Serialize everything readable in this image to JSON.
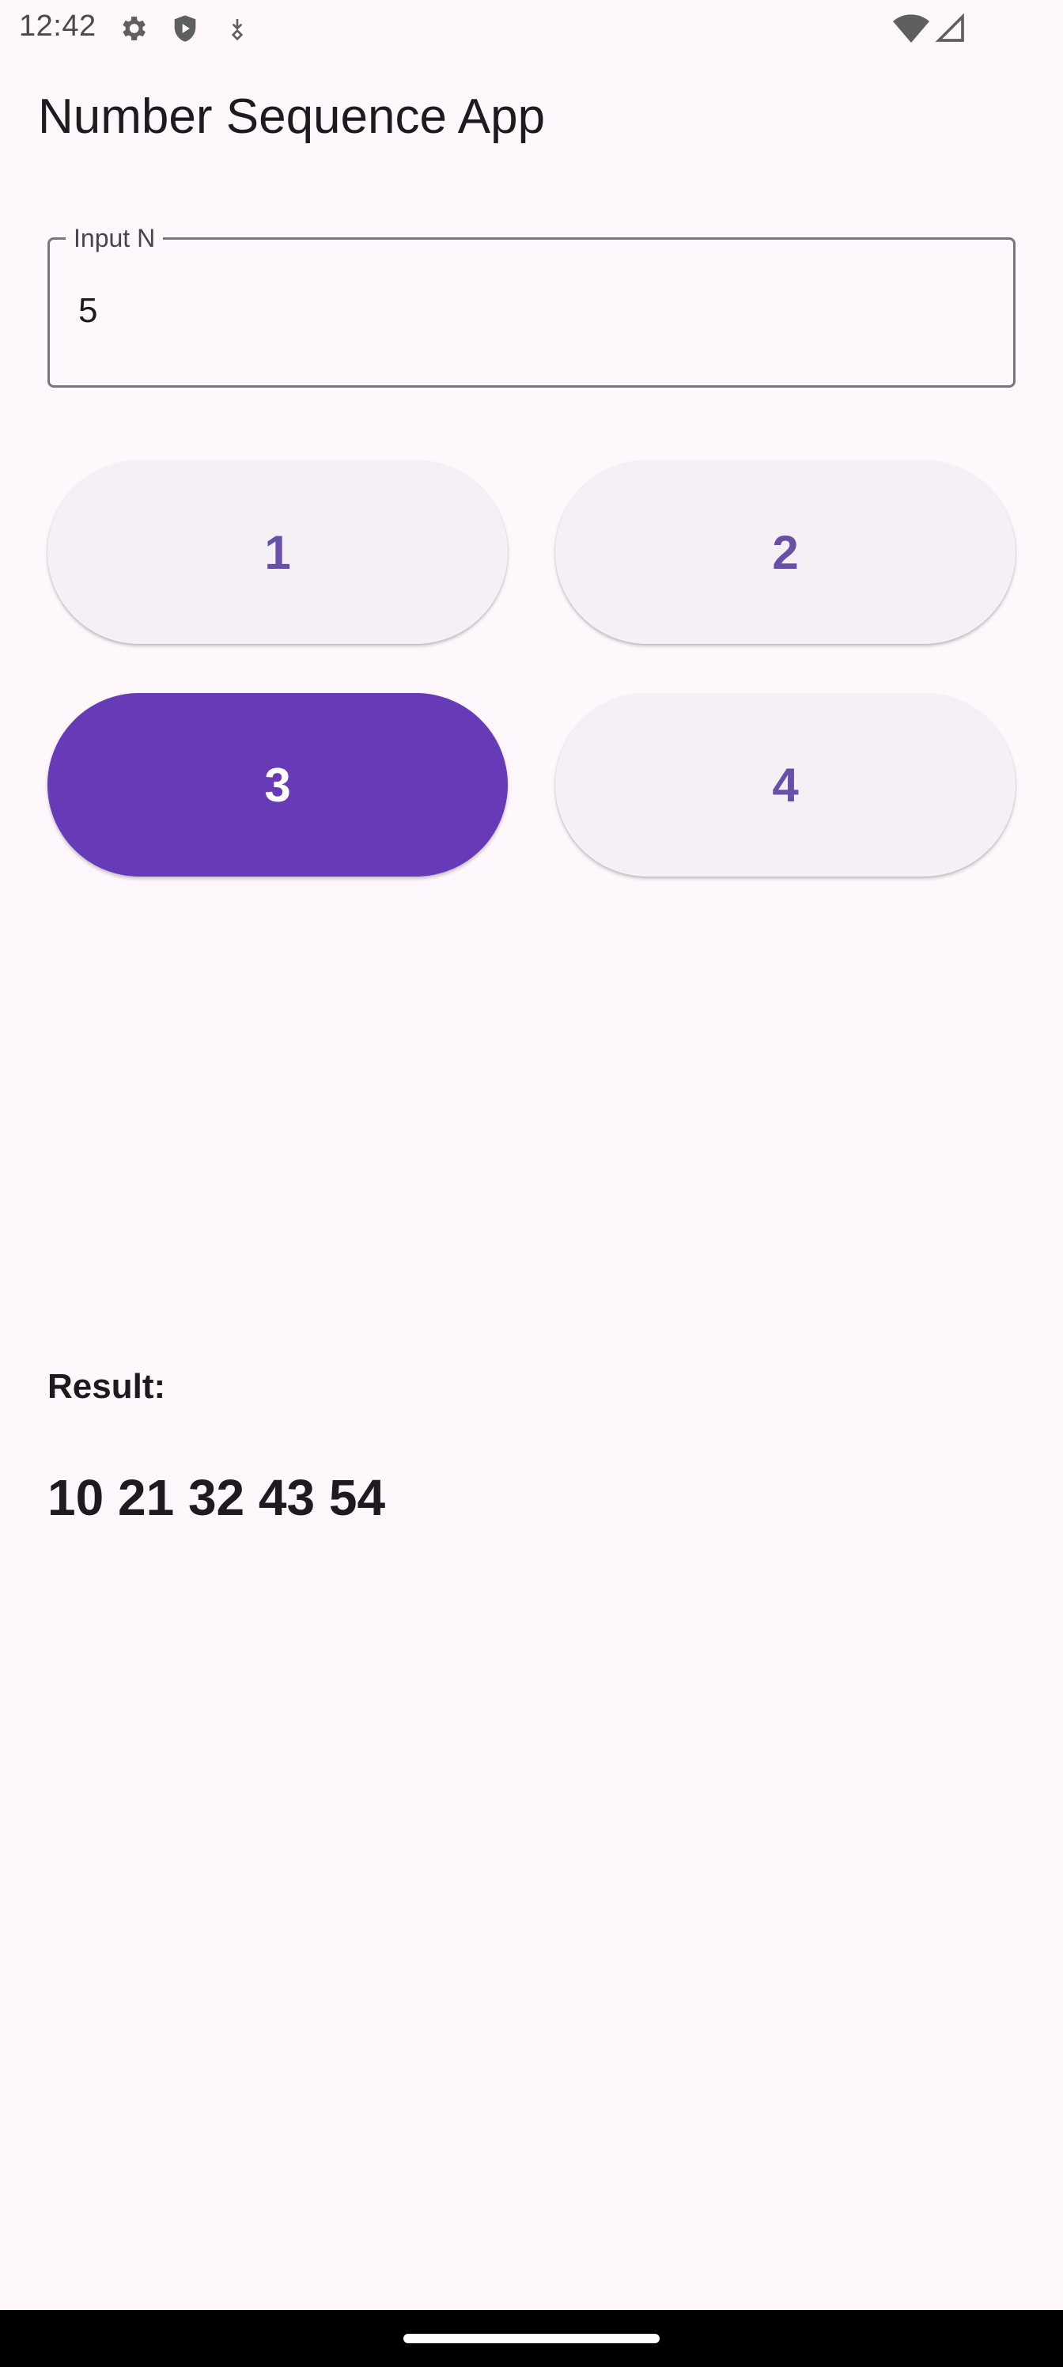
{
  "status_bar": {
    "time": "12:42",
    "icons_left": [
      "settings-icon",
      "shield-play-icon",
      "download-status-icon"
    ],
    "icons_right": [
      "wifi-icon",
      "cell-signal-icon"
    ]
  },
  "app_bar": {
    "title": "Number Sequence App"
  },
  "input": {
    "label": "Input N",
    "value": "5"
  },
  "buttons": [
    {
      "label": "1",
      "selected": false
    },
    {
      "label": "2",
      "selected": false
    },
    {
      "label": "3",
      "selected": true
    },
    {
      "label": "4",
      "selected": false
    }
  ],
  "result": {
    "label": "Result:",
    "value": "10 21 32 43 54"
  },
  "colors": {
    "background": "#fef7fc",
    "primary": "#673ab7",
    "tonal_button": "#f4f0f6",
    "tonal_text": "#6a4fa8",
    "outline": "#79747e"
  }
}
